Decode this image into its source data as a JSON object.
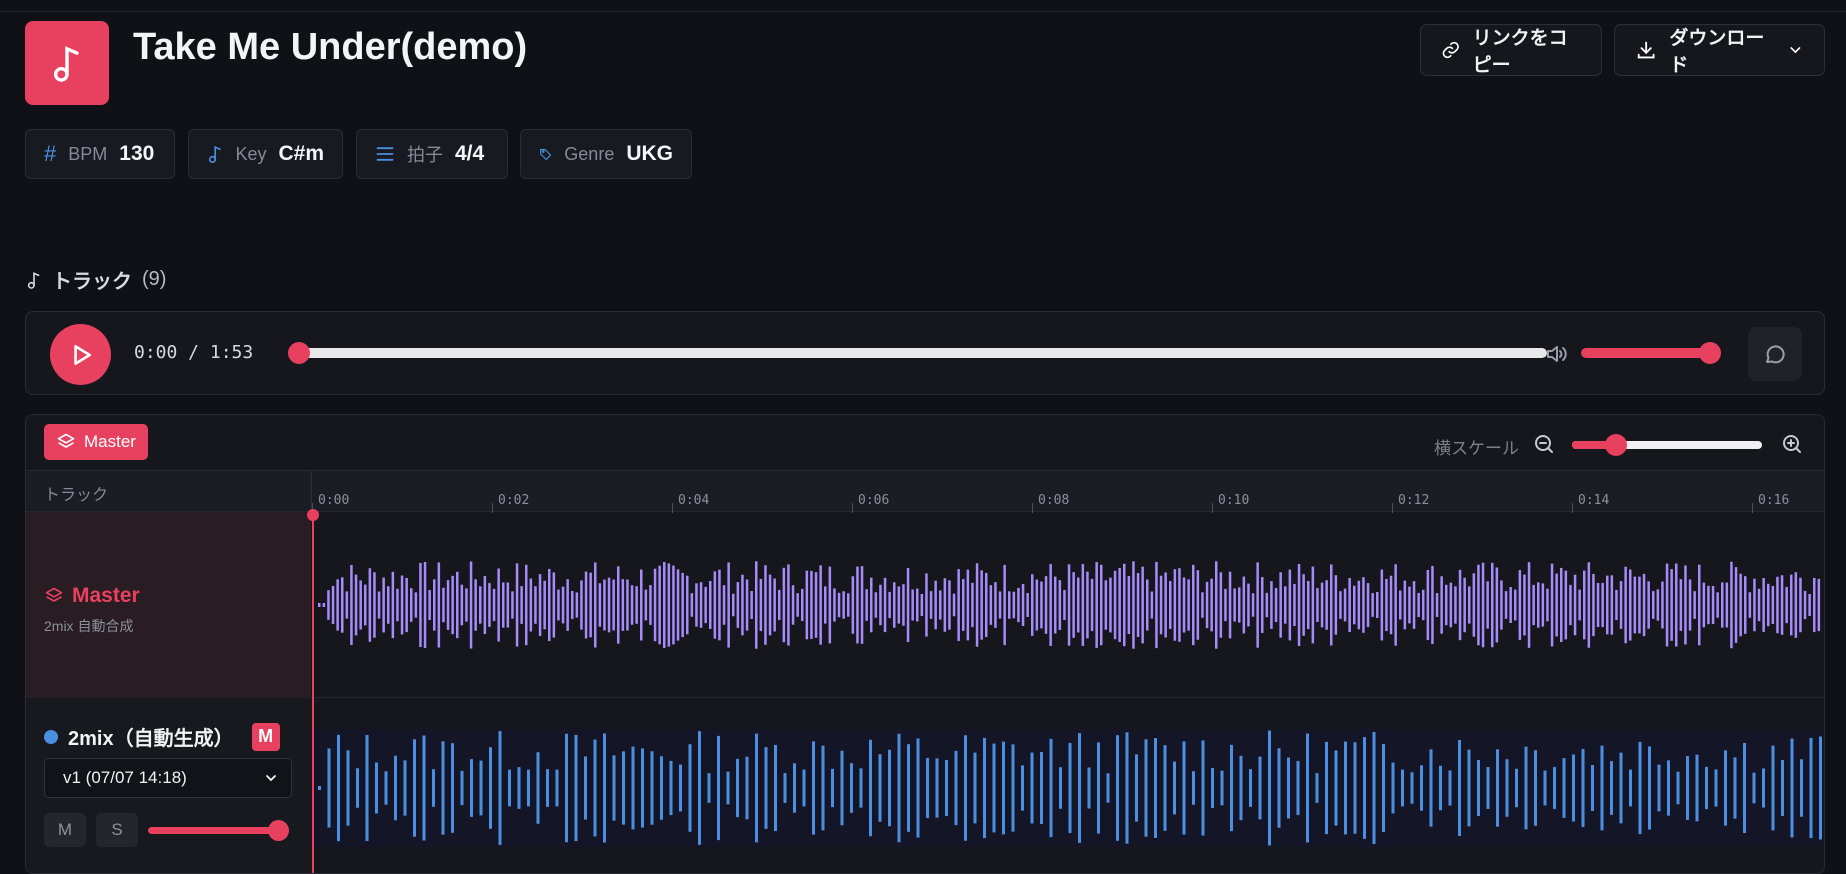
{
  "header": {
    "title": "Take Me Under(demo)",
    "copy_link_label": "リンクをコピー",
    "download_label": "ダウンロード"
  },
  "meta": [
    {
      "icon": "hash-icon",
      "label": "BPM",
      "value": "130"
    },
    {
      "icon": "music-note-icon",
      "label": "Key",
      "value": "C#m"
    },
    {
      "icon": "list-icon",
      "label": "拍子",
      "value": "4/4"
    },
    {
      "icon": "tag-icon",
      "label": "Genre",
      "value": "UKG"
    }
  ],
  "tracks": {
    "heading": "トラック",
    "count": "(9)"
  },
  "player": {
    "time": "0:00 / 1:53",
    "progress": 0,
    "volume": 1.0
  },
  "timeline": {
    "master_label": "Master",
    "scale_label": "横スケール",
    "track_col_label": "トラック",
    "ticks": [
      "0:00",
      "0:02",
      "0:04",
      "0:06",
      "0:08",
      "0:10",
      "0:12",
      "0:14",
      "0:16"
    ]
  },
  "master_track": {
    "name": "Master",
    "subtitle": "2mix 自動合成"
  },
  "mix_track": {
    "name": "2mix（自動生成）",
    "badge": "M",
    "version": "v1 (07/07 14:18)",
    "mute_label": "M",
    "solo_label": "S"
  },
  "colors": {
    "accent": "#e8415f",
    "master_wave": "#a78bfa",
    "mix_wave": "#4a8fe0"
  }
}
